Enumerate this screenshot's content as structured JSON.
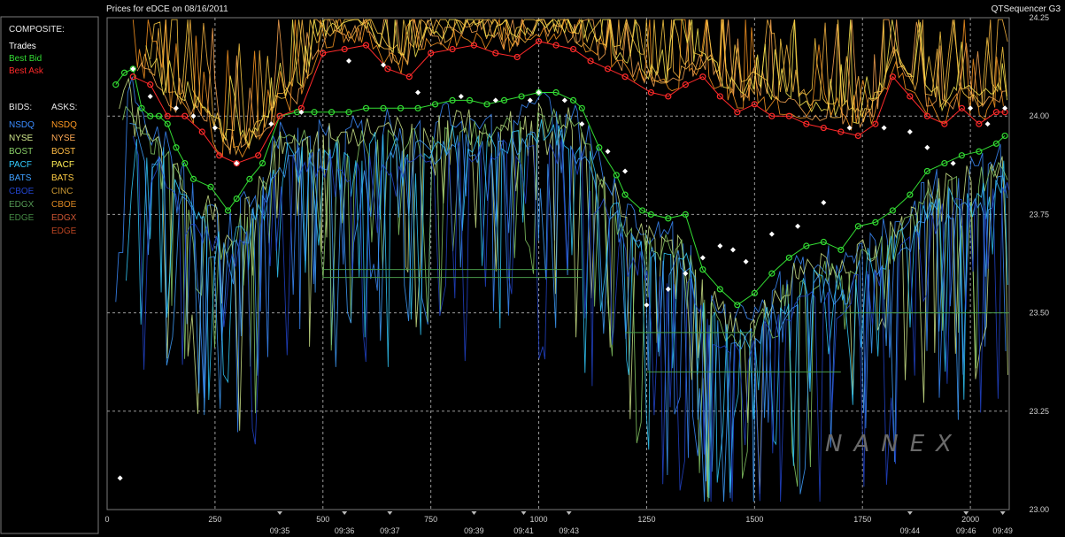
{
  "header": {
    "title": "Prices for  eDCE  on  08/16/2011",
    "app_name": "QTSequencer G3"
  },
  "watermark": "NANEX",
  "legend": {
    "composite_title": "COMPOSITE:",
    "composite_items": [
      {
        "label": "Trades",
        "color": "#ffffff"
      },
      {
        "label": "Best Bid",
        "color": "#33dd33"
      },
      {
        "label": "Best Ask",
        "color": "#ff2a2a"
      }
    ],
    "bids_title": "BIDS:",
    "asks_title": "ASKS:",
    "bids": [
      {
        "label": "NSDQ",
        "color": "#3b8cff"
      },
      {
        "label": "NYSE",
        "color": "#cfe68a"
      },
      {
        "label": "BOST",
        "color": "#88cc66"
      },
      {
        "label": "PACF",
        "color": "#33ccff"
      },
      {
        "label": "BATS",
        "color": "#3fa0ff"
      },
      {
        "label": "CBOE",
        "color": "#2244cc"
      },
      {
        "label": "EDGX",
        "color": "#559955"
      },
      {
        "label": "EDGE",
        "color": "#448844"
      }
    ],
    "asks": [
      {
        "label": "NSDQ",
        "color": "#ff9922"
      },
      {
        "label": "NYSE",
        "color": "#ffaa55"
      },
      {
        "label": "BOST",
        "color": "#ffbb44"
      },
      {
        "label": "PACF",
        "color": "#ffee55"
      },
      {
        "label": "BATS",
        "color": "#ffcc44"
      },
      {
        "label": "CINC",
        "color": "#cc9933"
      },
      {
        "label": "CBOE",
        "color": "#dd8822"
      },
      {
        "label": "EDGX",
        "color": "#cc5533"
      },
      {
        "label": "EDGE",
        "color": "#bb4422"
      }
    ]
  },
  "chart_data": {
    "type": "line",
    "xlim": [
      0,
      2090
    ],
    "ylim": [
      23.0,
      24.25
    ],
    "grid": true,
    "y_ticks": [
      "24.25",
      "24.00",
      "23.75",
      "23.50",
      "23.25",
      "23.00"
    ],
    "y_tick_values": [
      24.25,
      24.0,
      23.75,
      23.5,
      23.25,
      23.0
    ],
    "x_ticks": [
      {
        "label": "0",
        "value": 0
      },
      {
        "label": "250",
        "value": 250
      },
      {
        "label": "500",
        "value": 500
      },
      {
        "label": "750",
        "value": 750
      },
      {
        "label": "1000",
        "value": 1000
      },
      {
        "label": "1250",
        "value": 1250
      },
      {
        "label": "1500",
        "value": 1500
      },
      {
        "label": "1750",
        "value": 1750
      },
      {
        "label": "2000",
        "value": 2000
      }
    ],
    "time_labels": [
      {
        "label": "09:35",
        "value": 400
      },
      {
        "label": "09:36",
        "value": 550
      },
      {
        "label": "09:37",
        "value": 655
      },
      {
        "label": "09:39",
        "value": 850
      },
      {
        "label": "09:41",
        "value": 965
      },
      {
        "label": "09:43",
        "value": 1070
      },
      {
        "label": "09:44",
        "value": 1860
      },
      {
        "label": "09:46",
        "value": 1990
      },
      {
        "label": "09:49",
        "value": 2075
      }
    ],
    "series": [
      {
        "name": "Best Bid",
        "color": "#33dd33",
        "x": [
          20,
          40,
          60,
          80,
          100,
          120,
          140,
          160,
          180,
          200,
          240,
          280,
          300,
          330,
          360,
          400,
          440,
          480,
          520,
          560,
          600,
          640,
          680,
          720,
          760,
          800,
          840,
          880,
          920,
          960,
          1000,
          1040,
          1080,
          1100,
          1140,
          1180,
          1200,
          1240,
          1260,
          1300,
          1340,
          1380,
          1420,
          1460,
          1500,
          1540,
          1580,
          1620,
          1660,
          1700,
          1740,
          1780,
          1820,
          1860,
          1900,
          1940,
          1980,
          2020,
          2060,
          2080
        ],
        "y": [
          24.08,
          24.11,
          24.12,
          24.02,
          24.0,
          24.0,
          23.98,
          23.92,
          23.88,
          23.84,
          23.82,
          23.76,
          23.79,
          23.84,
          23.88,
          24.0,
          24.01,
          24.01,
          24.01,
          24.01,
          24.02,
          24.02,
          24.02,
          24.02,
          24.03,
          24.04,
          24.04,
          24.03,
          24.04,
          24.05,
          24.06,
          24.06,
          24.04,
          24.02,
          23.92,
          23.85,
          23.8,
          23.76,
          23.75,
          23.74,
          23.75,
          23.61,
          23.56,
          23.52,
          23.55,
          23.6,
          23.64,
          23.67,
          23.68,
          23.66,
          23.72,
          23.73,
          23.76,
          23.8,
          23.86,
          23.88,
          23.9,
          23.91,
          23.93,
          23.95
        ]
      },
      {
        "name": "Best Ask",
        "color": "#ff2a2a",
        "x": [
          60,
          100,
          140,
          180,
          220,
          260,
          300,
          350,
          400,
          450,
          500,
          550,
          600,
          650,
          700,
          750,
          800,
          850,
          900,
          950,
          1000,
          1040,
          1080,
          1120,
          1160,
          1200,
          1260,
          1300,
          1340,
          1380,
          1420,
          1460,
          1500,
          1540,
          1580,
          1620,
          1660,
          1700,
          1740,
          1780,
          1820,
          1860,
          1900,
          1940,
          1980,
          2020,
          2060,
          2080
        ],
        "y": [
          24.1,
          24.08,
          24.0,
          24.0,
          23.96,
          23.9,
          23.88,
          23.9,
          24.0,
          24.02,
          24.16,
          24.17,
          24.18,
          24.12,
          24.1,
          24.16,
          24.17,
          24.18,
          24.16,
          24.15,
          24.19,
          24.18,
          24.17,
          24.14,
          24.12,
          24.1,
          24.06,
          24.05,
          24.08,
          24.1,
          24.05,
          24.01,
          24.03,
          24.0,
          24.0,
          23.98,
          23.97,
          23.96,
          23.95,
          23.98,
          24.1,
          24.05,
          24.0,
          23.98,
          24.02,
          23.98,
          24.01,
          24.01
        ]
      },
      {
        "name": "Trades",
        "color": "#ffffff",
        "x": [
          30,
          60,
          100,
          160,
          200,
          250,
          300,
          380,
          450,
          560,
          640,
          720,
          820,
          900,
          980,
          1000,
          1060,
          1100,
          1160,
          1200,
          1250,
          1300,
          1340,
          1380,
          1420,
          1450,
          1480,
          1540,
          1600,
          1660,
          1720,
          1800,
          1860,
          1900,
          1960,
          2000,
          2040,
          2080
        ],
        "y": [
          23.08,
          24.12,
          24.05,
          24.02,
          24.0,
          23.97,
          23.88,
          23.98,
          24.01,
          24.14,
          24.13,
          24.06,
          24.05,
          24.04,
          24.04,
          24.06,
          24.04,
          23.98,
          23.91,
          23.86,
          23.52,
          23.56,
          23.6,
          23.64,
          23.67,
          23.66,
          23.63,
          23.7,
          23.72,
          23.78,
          23.97,
          23.97,
          23.96,
          23.92,
          23.88,
          24.02,
          23.98,
          24.02
        ]
      }
    ]
  }
}
